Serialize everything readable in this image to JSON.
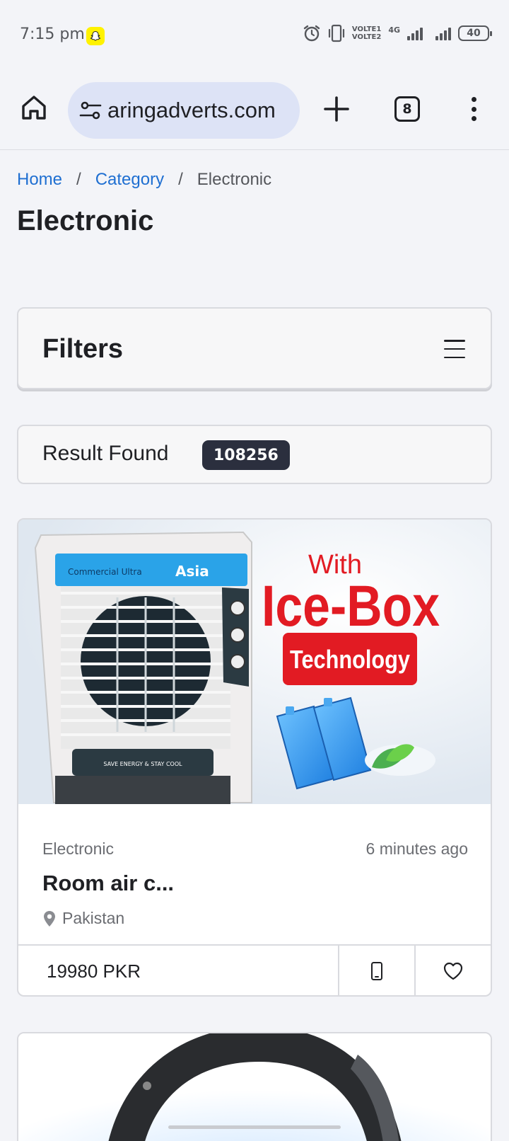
{
  "status_bar": {
    "time": "7:15 pm",
    "network_label": "VOLTE1\nVOLTE2",
    "network_type": "4G",
    "battery_level": "40",
    "icons": [
      "snapchat-icon",
      "alarm-icon",
      "vibrate-icon",
      "signal-icon",
      "battery-icon"
    ]
  },
  "browser": {
    "url": "aringadverts.com",
    "tab_count": "8",
    "icons": [
      "home-icon",
      "site-settings-icon",
      "new-tab-icon",
      "tabs-icon",
      "more-options-icon"
    ]
  },
  "breadcrumb": {
    "items": [
      {
        "label": "Home"
      },
      {
        "label": "Category"
      }
    ],
    "separator": "/",
    "current": "Electronic"
  },
  "page": {
    "title": "Electronic"
  },
  "filters": {
    "title": "Filters"
  },
  "results": {
    "label": "Result Found",
    "count": "108256"
  },
  "products": [
    {
      "image_text": {
        "with": "With",
        "headline": "Ice-Box",
        "badge": "Technology",
        "panel_brand": "Asia",
        "panel_left": "Commercial Ultra",
        "panel_bottom": "SAVE ENERGY & STAY COOL"
      },
      "category": "Electronic",
      "time": "6 minutes ago",
      "title": "Room air c...",
      "location": "Pakistan",
      "price": "19980 PKR"
    }
  ],
  "colors": {
    "link": "#1f6fd1",
    "badge_bg": "#2b2f3e",
    "url_pill": "#dde3f6",
    "ad_red": "#e21b23"
  }
}
